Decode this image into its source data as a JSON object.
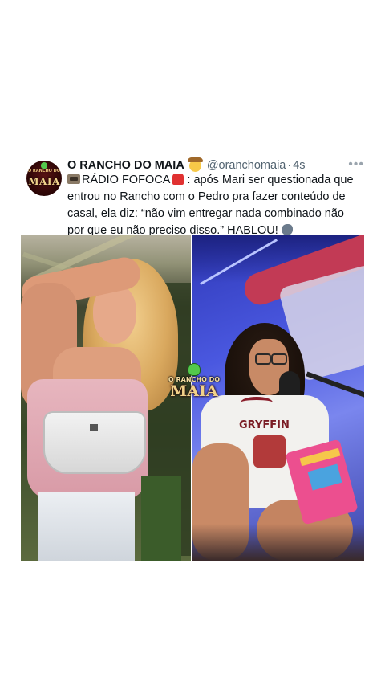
{
  "post": {
    "display_name": "O RANCHO DO MAIA",
    "handle": "@oranchomaia",
    "separator": "·",
    "time": "4s",
    "more_label": "•••",
    "text_part1": "RÁDIO FOFOCA",
    "text_part2": ": após Mari ser questionada que entrou no Rancho com o Pedro pra fazer conteúdo de casal, ela diz: “não vim entregar nada combinado não por que eu não preciso disso.” HABLOU!",
    "avatar_logo_top": "O RANCHO DO",
    "avatar_logo": "MAIA",
    "icons": [
      "radio-icon",
      "siren-icon",
      "speaking-head-icon",
      "cowboy-face-icon"
    ]
  },
  "media": {
    "watermark_top": "O RANCHO DO",
    "watermark_main": "MAIA",
    "shirt_text": "GRYFFIN",
    "colors": {
      "left_bg": "#3a4a2a",
      "right_bg": "#4a58e0",
      "watermark": "#e8c27a"
    }
  }
}
